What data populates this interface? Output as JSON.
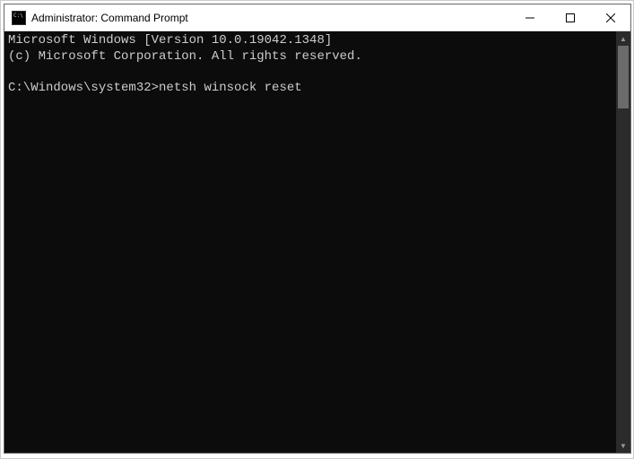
{
  "window": {
    "title": "Administrator: Command Prompt"
  },
  "terminal": {
    "line1": "Microsoft Windows [Version 10.0.19042.1348]",
    "line2": "(c) Microsoft Corporation. All rights reserved.",
    "blank": "",
    "prompt": "C:\\Windows\\system32>",
    "command": "netsh winsock reset"
  }
}
